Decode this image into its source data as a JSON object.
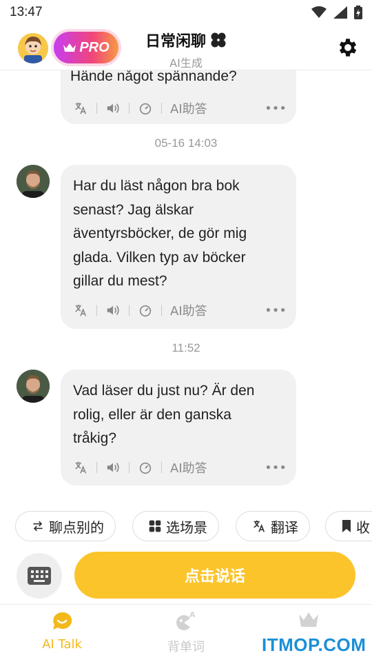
{
  "status_bar": {
    "time": "13:47"
  },
  "header": {
    "pro_label": "PRO",
    "title": "日常闲聊",
    "subtitle": "AI生成"
  },
  "messages": [
    {
      "text": "Hände något spännande?",
      "partial": true
    },
    {
      "timestamp": "05-16 14:03",
      "text": "Har du läst någon bra bok senast? Jag älskar äventyrsböcker, de gör mig glada. Vilken typ av böcker gillar du mest?"
    },
    {
      "timestamp": "11:52",
      "text": "Vad läser du just nu? Är den rolig, eller är den ganska tråkig?"
    }
  ],
  "message_actions": {
    "ai_answer_label": "AI助答",
    "more": "•••"
  },
  "chips": [
    {
      "label": "聊点别的",
      "icon": "swap-icon"
    },
    {
      "label": "选场景",
      "icon": "grid-icon"
    },
    {
      "label": "翻译",
      "icon": "translate-icon"
    },
    {
      "label": "收",
      "icon": "bookmark-icon"
    }
  ],
  "talk_button_label": "点击说话",
  "bottom_nav": [
    {
      "label": "AI Talk",
      "active": true
    },
    {
      "label": "背单词",
      "active": false
    },
    {
      "label": "",
      "active": false
    }
  ],
  "watermark": "ITMOP.COM",
  "colors": {
    "accent": "#fcc42b",
    "bubble": "#f1f1f1",
    "active_nav": "#f3b81a",
    "inactive_nav": "#c8c8c8"
  }
}
